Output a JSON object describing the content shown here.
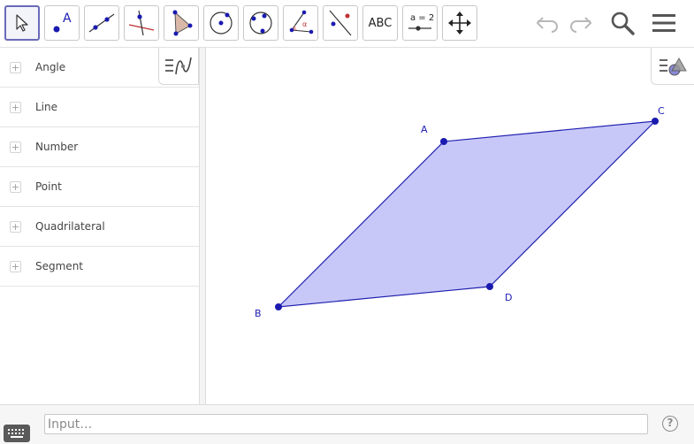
{
  "toolbar": {
    "tools": [
      {
        "name": "move-tool",
        "icon": "cursor-arrow-icon"
      },
      {
        "name": "point-tool",
        "icon": "point-icon",
        "label": "A"
      },
      {
        "name": "line-tool",
        "icon": "line-through-two-points-icon"
      },
      {
        "name": "perpendicular-line-tool",
        "icon": "perpendicular-line-icon"
      },
      {
        "name": "polygon-tool",
        "icon": "polygon-icon"
      },
      {
        "name": "circle-tool",
        "icon": "circle-center-point-icon"
      },
      {
        "name": "circle-three-points-tool",
        "icon": "circle-three-points-icon"
      },
      {
        "name": "angle-tool",
        "icon": "angle-icon"
      },
      {
        "name": "reflect-tool",
        "icon": "reflect-about-line-icon"
      },
      {
        "name": "text-tool",
        "icon": "text-icon",
        "label": "ABC"
      },
      {
        "name": "slider-tool",
        "icon": "slider-icon",
        "label": "a = 2"
      },
      {
        "name": "move-graphics-view-tool",
        "icon": "move-arrows-icon"
      }
    ],
    "right": [
      "undo-icon",
      "redo-icon",
      "search-icon",
      "menu-icon"
    ]
  },
  "algebra": {
    "categories": [
      {
        "label": "Angle"
      },
      {
        "label": "Line"
      },
      {
        "label": "Number"
      },
      {
        "label": "Point"
      },
      {
        "label": "Quadrilateral"
      },
      {
        "label": "Segment"
      }
    ]
  },
  "graphics": {
    "points": [
      {
        "label": "A"
      },
      {
        "label": "B"
      },
      {
        "label": "C"
      },
      {
        "label": "D"
      }
    ],
    "polygon_fill": "#c8c8f8",
    "accent": "#1f1fb0"
  },
  "input": {
    "placeholder": "Input…"
  },
  "help": {
    "label": "?"
  },
  "colors": {
    "point": "#1a1ab0",
    "active_tool_border": "#6a6ab8"
  }
}
